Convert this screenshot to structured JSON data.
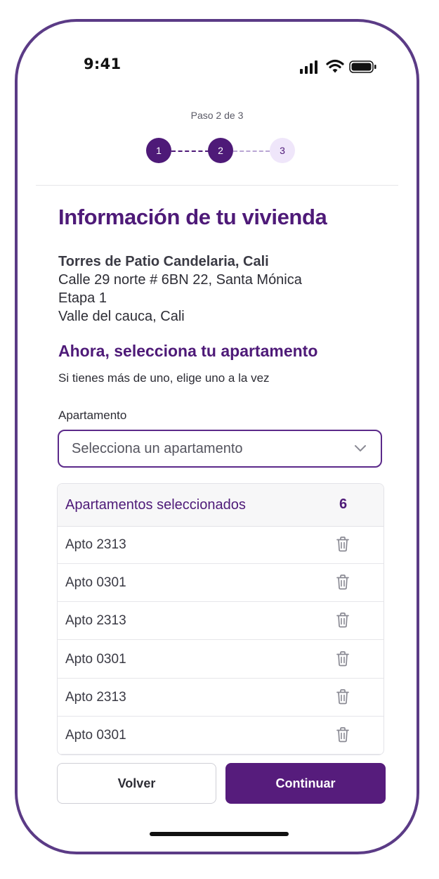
{
  "status_bar": {
    "time": "9:41",
    "icons": [
      "signal-icon",
      "wifi-icon",
      "battery-icon"
    ]
  },
  "stepper": {
    "label": "Paso  2 de 3",
    "steps": [
      "1",
      "2",
      "3"
    ],
    "current_step": 2,
    "total_steps": 3
  },
  "page": {
    "title": "Información de tu vivienda"
  },
  "address": {
    "name": "Torres de Patio Candelaria, Cali",
    "line1": "Calle 29 norte # 6BN 22, Santa Mónica",
    "line2": "Etapa 1",
    "line3": "Valle del cauca, Cali"
  },
  "selection": {
    "title": "Ahora, selecciona tu apartamento",
    "helper": "Si tienes más de uno, elige uno a la vez",
    "field_label": "Apartamento",
    "placeholder": "Selecciona un apartamento"
  },
  "table": {
    "header": "Apartamentos seleccionados",
    "count": "6",
    "rows": [
      "Apto 2313",
      "Apto 0301",
      "Apto 2313",
      "Apto 0301",
      "Apto 2313",
      "Apto 0301"
    ]
  },
  "buttons": {
    "back": "Volver",
    "continue": "Continuar"
  },
  "colors": {
    "primary": "#4e1a78",
    "button": "#561c7c",
    "frame": "#5b3b86",
    "step_pending_bg": "#efe6fa"
  }
}
